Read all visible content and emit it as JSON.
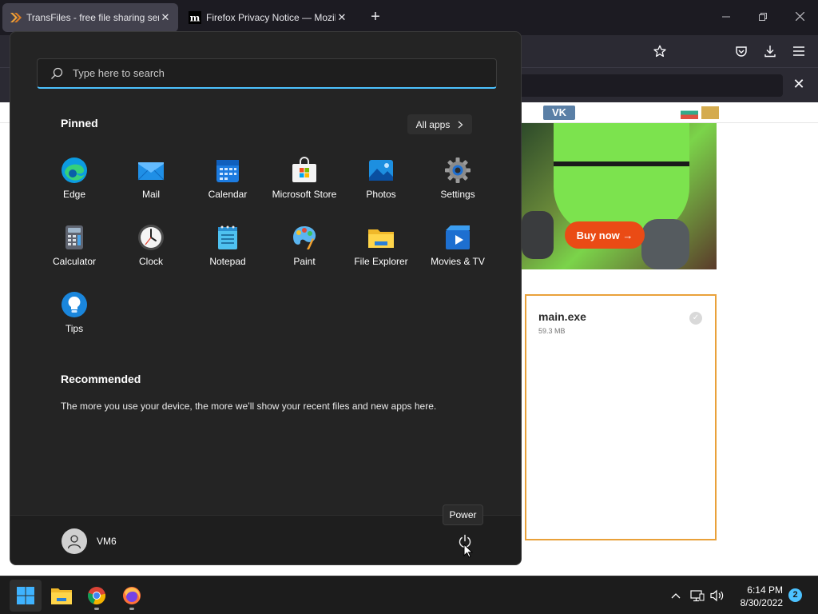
{
  "browser": {
    "tabs": [
      {
        "title": "TransFiles - free file sharing servi",
        "icon": "transfiles-chevron-icon",
        "active": true
      },
      {
        "title": "Firefox Privacy Notice — Mozilla",
        "icon": "mozilla-m-icon",
        "active": false
      }
    ],
    "new_tab_glyph": "+",
    "close_glyph": "✕"
  },
  "website": {
    "vk_label": "VK",
    "ad_button_label": "Buy now →",
    "file": {
      "name": "main.exe",
      "size": "59.3 MB"
    }
  },
  "start_menu": {
    "search_placeholder": "Type here to search",
    "pinned_title": "Pinned",
    "all_apps_label": "All apps",
    "pinned_apps": [
      {
        "label": "Edge",
        "icon": "edge-icon"
      },
      {
        "label": "Mail",
        "icon": "mail-icon"
      },
      {
        "label": "Calendar",
        "icon": "calendar-icon"
      },
      {
        "label": "Microsoft Store",
        "icon": "store-icon"
      },
      {
        "label": "Photos",
        "icon": "photos-icon"
      },
      {
        "label": "Settings",
        "icon": "settings-gear-icon"
      },
      {
        "label": "Calculator",
        "icon": "calculator-icon"
      },
      {
        "label": "Clock",
        "icon": "clock-icon"
      },
      {
        "label": "Notepad",
        "icon": "notepad-icon"
      },
      {
        "label": "Paint",
        "icon": "paint-icon"
      },
      {
        "label": "File Explorer",
        "icon": "folder-icon"
      },
      {
        "label": "Movies & TV",
        "icon": "movies-icon"
      },
      {
        "label": "Tips",
        "icon": "tips-bulb-icon"
      }
    ],
    "recommended_title": "Recommended",
    "recommended_text": "The more you use your device, the more we’ll show your recent files and new apps here.",
    "user_name": "VM6",
    "power_tooltip": "Power"
  },
  "taskbar": {
    "clock_time": "6:14 PM",
    "clock_date": "8/30/2022",
    "notification_count": "2"
  },
  "colors": {
    "accent": "#4cc2ff",
    "menu_bg": "#242424",
    "ad_button": "#ea4b15",
    "file_card_border": "#e9a13a"
  }
}
